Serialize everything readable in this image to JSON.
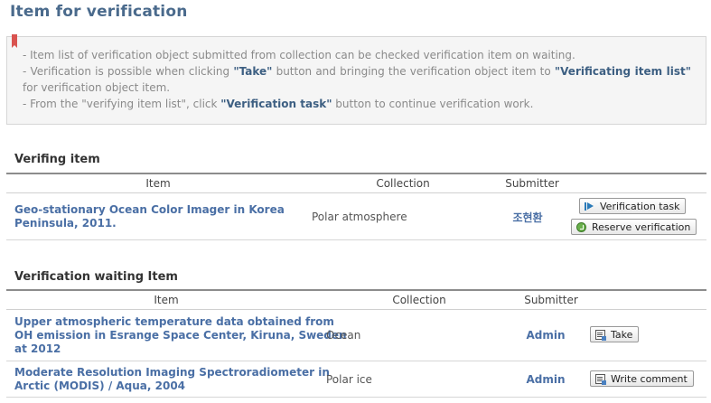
{
  "page": {
    "title": "Item for verification"
  },
  "notice": {
    "line1": "- Item list of verification object submitted from collection can be checked verification item on waiting.",
    "line2_prefix": "- Verification is possible when clicking ",
    "line2_take": "\"Take\"",
    "line2_middle": " button and bringing the verification object item to ",
    "line2_list": "\"Verificating item list\"",
    "line2_suffix": " for verification object item.",
    "line3_prefix": "- From the \"verifying item list\", click ",
    "line3_task": "\"Verification task\"",
    "line3_suffix": " button to continue verification work."
  },
  "verifying": {
    "title": "Verifing item",
    "columns": {
      "item": "Item",
      "collection": "Collection",
      "submitter": "Submitter"
    },
    "rows": [
      {
        "item_line1": "Geo-stationary Ocean Color Imager in Korea",
        "item_line2": "Peninsula, 2011.",
        "collection": "Polar atmosphere",
        "submitter": "조현환",
        "button1": "Verification task",
        "button2": "Reserve verification"
      }
    ]
  },
  "waiting": {
    "title": "Verification waiting Item",
    "columns": {
      "item": "Item",
      "collection": "Collection",
      "submitter": "Submitter"
    },
    "rows": [
      {
        "item_line1": "Upper atmospheric temperature data obtained from",
        "item_line2": "OH emission in Esrange Space Center, Kiruna, Sweden",
        "item_line3": "at 2012",
        "collection": "Ocean",
        "submitter": "Admin",
        "button": "Take"
      },
      {
        "item_line1": "Moderate Resolution Imaging Spectroradiometer in",
        "item_line2": "Arctic (MODIS) / Aqua, 2004",
        "collection": "Polar ice",
        "submitter": "Admin",
        "button": "Write comment"
      }
    ]
  },
  "icons": {
    "verification_task": "play-icon",
    "reserve": "reserve-icon",
    "take": "document-icon",
    "comment": "document-icon"
  }
}
